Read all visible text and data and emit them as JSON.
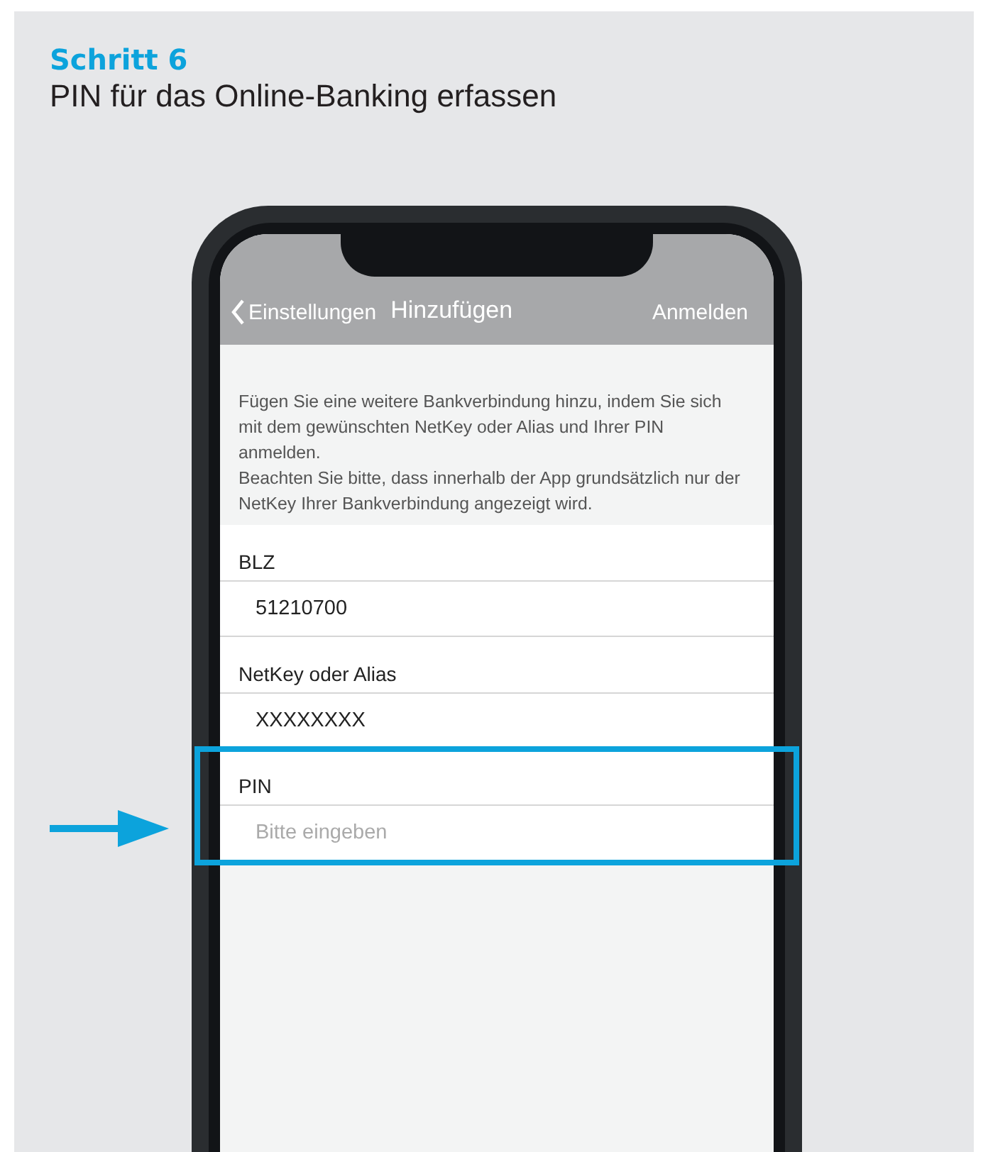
{
  "header": {
    "step": "Schritt 6",
    "title": "PIN für das Online-Banking erfassen"
  },
  "nav": {
    "back": "Einstellungen",
    "title": "Hinzufügen",
    "action": "Anmelden"
  },
  "intro": [
    "Fügen Sie eine weitere Bankverbindung hinzu, indem Sie sich mit dem gewünschten NetKey oder Alias und Ihrer PIN anmelden.",
    "Beachten Sie bitte, dass innerhalb der App grundsätzlich nur der NetKey Ihrer Bankverbindung angezeigt wird."
  ],
  "fields": [
    {
      "label": "BLZ",
      "value": "51210700",
      "highlighted": false
    },
    {
      "label": "NetKey oder Alias",
      "value": "XXXXXXXX",
      "highlighted": false
    },
    {
      "label": "PIN",
      "placeholder": "Bitte eingeben",
      "highlighted": true
    }
  ]
}
